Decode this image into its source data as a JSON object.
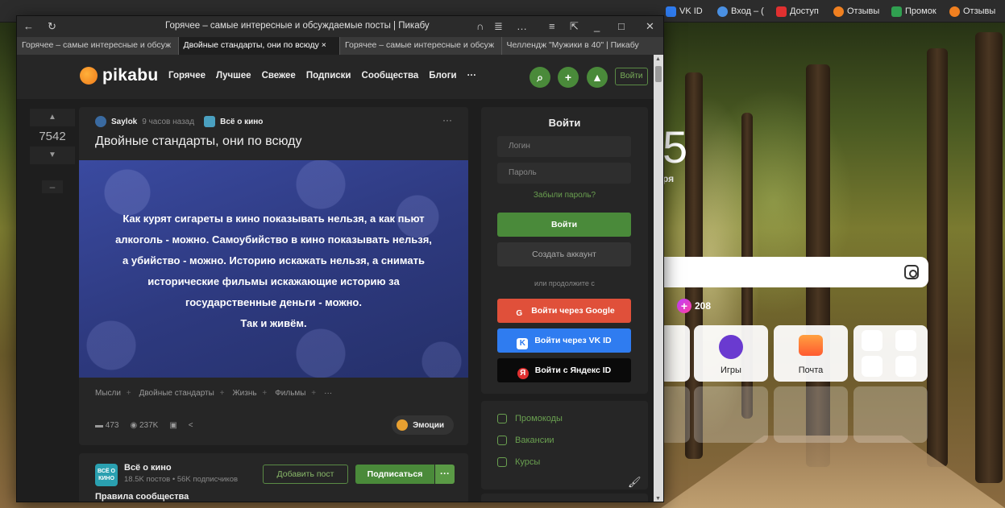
{
  "background_browser": {
    "bookmarks": [
      {
        "label": "VK ID",
        "color": "#2f7cf0"
      },
      {
        "label": "Вход – (",
        "color": "#4a90e2"
      },
      {
        "label": "Доступ",
        "color": "#e03030"
      },
      {
        "label": "Отзывы",
        "color": "#f08020"
      },
      {
        "label": "Промок",
        "color": "#30a050"
      },
      {
        "label": "Отзывы",
        "color": "#f08020"
      }
    ],
    "time_fragment": "5",
    "subtitle_fragment": "ря",
    "counter": "208",
    "tiles": [
      {
        "label": "Игры"
      },
      {
        "label": "Почта"
      }
    ]
  },
  "window": {
    "title": "Горячее – самые интересные и обсуждаемые посты | Пикабу",
    "tabs": [
      {
        "label": "Горячее – самые интересные и обсуж",
        "active": false
      },
      {
        "label": "Двойные стандарты, они по всюду",
        "active": true
      },
      {
        "label": "Горячее – самые интересные и обсуж",
        "active": false
      },
      {
        "label": "Челлендж \"Мужики в 40\" | Пикабу",
        "active": false
      }
    ]
  },
  "header": {
    "logo": "pikabu",
    "nav": [
      "Горячее",
      "Лучшее",
      "Свежее",
      "Подписки",
      "Сообщества",
      "Блоги",
      "···"
    ],
    "login": "Войти"
  },
  "post": {
    "rating": "7542",
    "author": "Saylok",
    "time": "9 часов назад",
    "community": "Всё о кино",
    "title": "Двойные стандарты, они по всюду",
    "quote_lines": [
      "Как курят сигареты в кино показывать нельзя, а как пьют",
      "алкоголь - можно. Самоубийство в кино показывать нельзя,",
      "а убийство - можно. Историю искажать нельзя, а снимать",
      "исторические фильмы искажающие историю за",
      "государственные деньги - можно.",
      "Так и живём."
    ],
    "tags": [
      "Мысли",
      "Двойные стандарты",
      "Жизнь",
      "Фильмы"
    ],
    "tags_more": "···",
    "comments": "473",
    "views": "237K",
    "emotions": "Эмоции"
  },
  "community_box": {
    "logo_text": "ВСЁ О КИНО",
    "name": "Всё о кино",
    "stats": "18.5K постов • 56K подписчиков",
    "add_post": "Добавить пост",
    "subscribe": "Подписаться",
    "more": "···",
    "rules": "Правила сообщества"
  },
  "sidebar": {
    "title": "Войти",
    "login_placeholder": "Логин",
    "password_placeholder": "Пароль",
    "forgot": "Забыли пароль?",
    "login_btn": "Войти",
    "create_btn": "Создать аккаунт",
    "or": "или продолжите с",
    "google_btn": "Войти через Google",
    "vk_btn": "Войти через VK ID",
    "yandex_btn": "Войти с Яндекс ID",
    "links": [
      "Промокоды",
      "Вакансии",
      "Курсы"
    ]
  }
}
